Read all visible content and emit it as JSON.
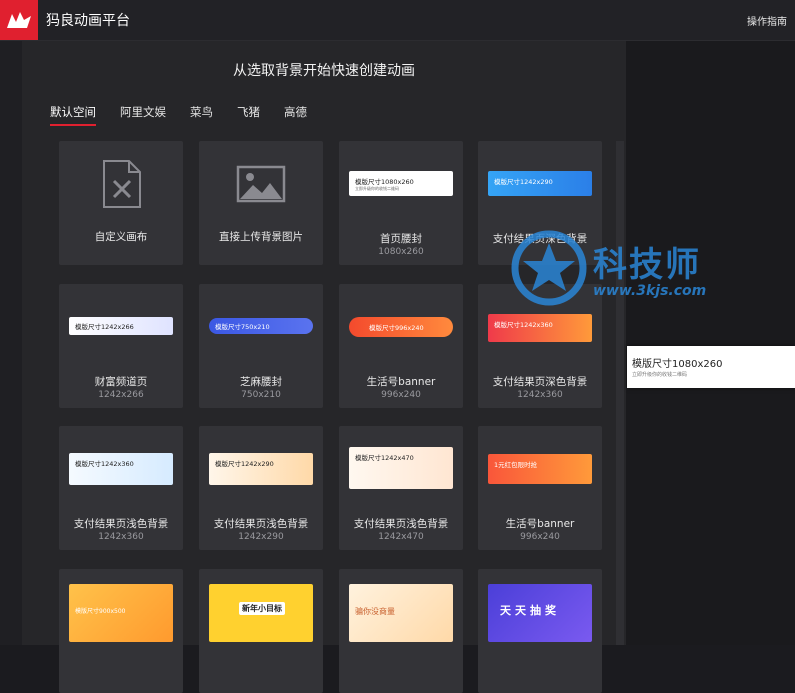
{
  "header": {
    "app_title": "犸良动画平台",
    "guide_link": "操作指南"
  },
  "main": {
    "heading": "从选取背景开始快速创建动画",
    "tabs": [
      {
        "label": "默认空间",
        "active": true
      },
      {
        "label": "阿里文娱",
        "active": false
      },
      {
        "label": "菜鸟",
        "active": false
      },
      {
        "label": "飞猪",
        "active": false
      },
      {
        "label": "高德",
        "active": false
      }
    ],
    "cards": [
      {
        "label": "自定义画布",
        "size": "",
        "kind": "custom"
      },
      {
        "label": "直接上传背景图片",
        "size": "",
        "kind": "upload"
      },
      {
        "label": "首页腰封",
        "size": "1080x260",
        "thumb_title": "模版尺寸1080x260",
        "thumb_sub": "立即升级你的收钱二维码",
        "thumb_color": "#ffffff"
      },
      {
        "label": "支付结果页深色背景",
        "size": "",
        "thumb_title": "模版尺寸1242x290",
        "thumb_sub": "",
        "thumb_color": "#2f8ff0"
      },
      {
        "label": "财富频道页",
        "size": "1242x266",
        "thumb_title": "模版尺寸1242x266",
        "thumb_sub": "",
        "thumb_color": "#e9ecff"
      },
      {
        "label": "芝麻腰封",
        "size": "750x210",
        "thumb_title": "模版尺寸750x210",
        "thumb_sub": "",
        "thumb_color": "#4a62e6"
      },
      {
        "label": "生活号banner",
        "size": "996x240",
        "thumb_title": "模版尺寸996x240",
        "thumb_sub": "",
        "thumb_color": "#f5693a"
      },
      {
        "label": "支付结果页深色背景",
        "size": "1242x360",
        "thumb_title": "模版尺寸1242x360",
        "thumb_sub": "",
        "thumb_color": "#f1473c"
      },
      {
        "label": "支付结果页浅色背景",
        "size": "1242x360",
        "thumb_title": "模版尺寸1242x360",
        "thumb_sub": "",
        "thumb_color": "#e6f2ff"
      },
      {
        "label": "支付结果页浅色背景",
        "size": "1242x290",
        "thumb_title": "模版尺寸1242x290",
        "thumb_sub": "",
        "thumb_color": "#fff0dc"
      },
      {
        "label": "支付结果页浅色背景",
        "size": "1242x470",
        "thumb_title": "模版尺寸1242x470",
        "thumb_sub": "",
        "thumb_color": "#fff1e6"
      },
      {
        "label": "生活号banner",
        "size": "996x240",
        "thumb_title": "1元红包限时抢",
        "thumb_sub": "",
        "thumb_color": "#f86a36"
      },
      {
        "label": "",
        "size": "",
        "thumb_title": "模版尺寸900x500",
        "thumb_sub": "",
        "thumb_color": "#ffb240"
      },
      {
        "label": "",
        "size": "",
        "thumb_title": "新年小目标",
        "thumb_sub": "",
        "thumb_color": "#ffcf2e"
      },
      {
        "label": "",
        "size": "",
        "thumb_title": "骗你没商量",
        "thumb_sub": "",
        "thumb_color": "#ffe6c4"
      },
      {
        "label": "",
        "size": "",
        "thumb_title": "天天抽奖",
        "thumb_sub": "",
        "thumb_color": "#5b48e0"
      }
    ]
  },
  "floating_preview": {
    "title": "模版尺寸1080x260",
    "subtitle": "立即升级你的收钱二维码"
  },
  "watermark": {
    "text": "科技师",
    "url": "www.3kjs.com"
  },
  "colors": {
    "brand_red": "#e0202f",
    "background": "#1b1b1f",
    "card": "#333337"
  }
}
